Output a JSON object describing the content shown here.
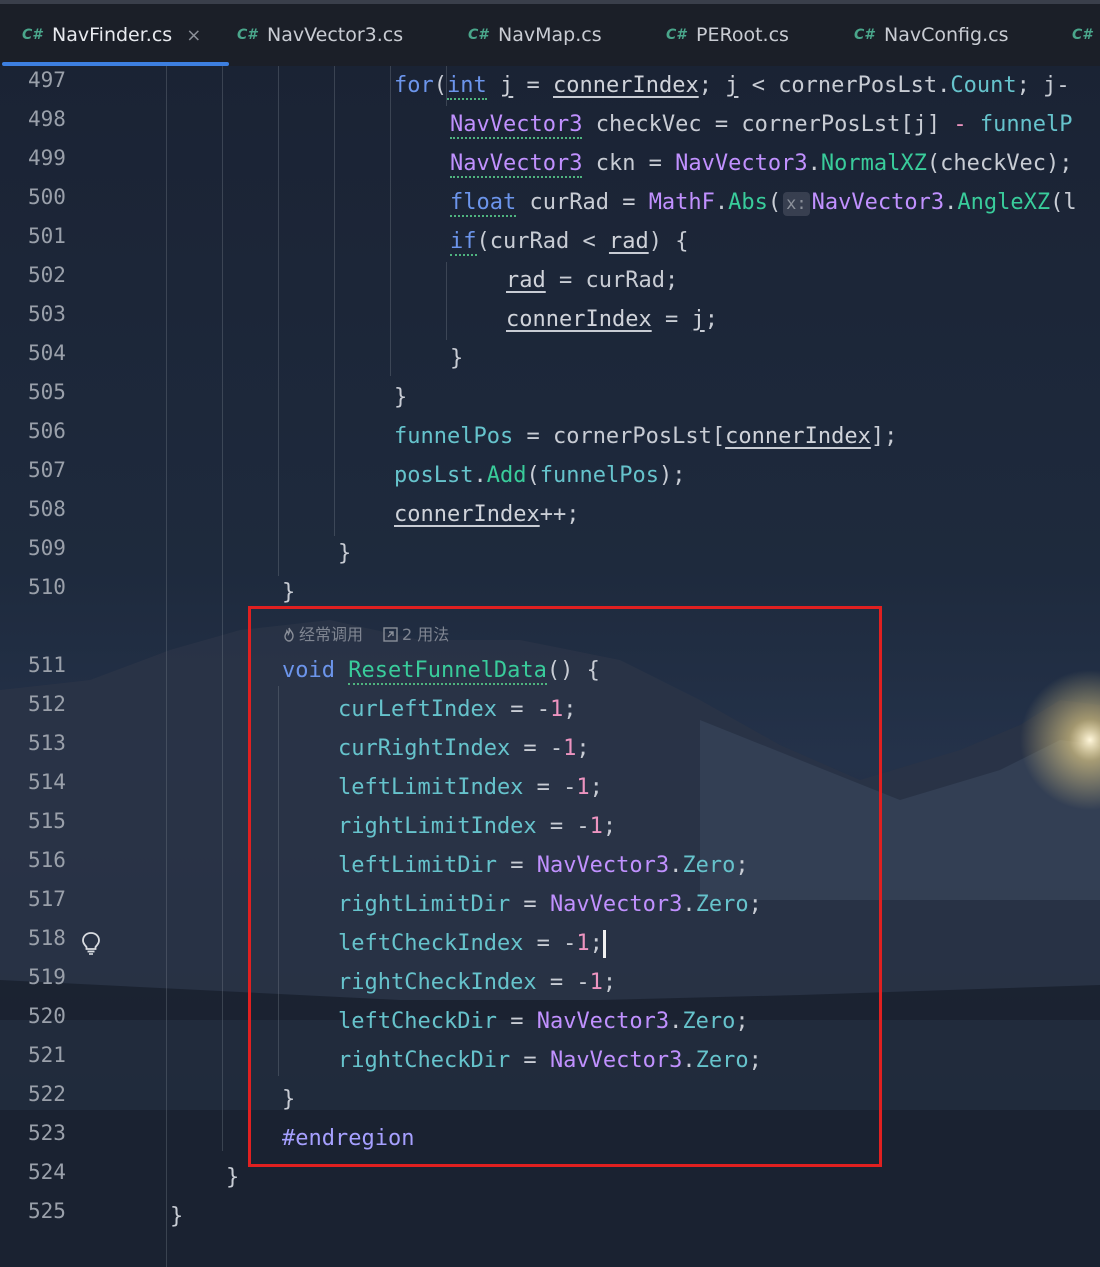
{
  "tabs": [
    {
      "lang": "C#",
      "label": "NavFinder.cs",
      "close": "×",
      "active": true
    },
    {
      "lang": "C#",
      "label": "NavVector3.cs"
    },
    {
      "lang": "C#",
      "label": "NavMap.cs"
    },
    {
      "lang": "C#",
      "label": "PERoot.cs"
    },
    {
      "lang": "C#",
      "label": "NavConfig.cs"
    },
    {
      "lang": "C#",
      "label": ""
    }
  ],
  "hints": {
    "frequency": "经常调用",
    "usages": "2 用法"
  },
  "inlay_param": "x:",
  "line_numbers": [
    "497",
    "498",
    "499",
    "500",
    "501",
    "502",
    "503",
    "504",
    "505",
    "506",
    "507",
    "508",
    "509",
    "510",
    "511",
    "512",
    "513",
    "514",
    "515",
    "516",
    "517",
    "518",
    "519",
    "520",
    "521",
    "522",
    "523",
    "524",
    "525"
  ],
  "code": {
    "l497": [
      "for",
      "(",
      "int",
      " ",
      "j",
      " = ",
      "connerIndex",
      "; ",
      "j",
      " < cornerPosLst.",
      "Count",
      "; j-"
    ],
    "l498": [
      "NavVector3",
      " checkVec = cornerPosLst[j] ",
      "-",
      " funnelP"
    ],
    "l499": [
      "NavVector3",
      " ckn = ",
      "NavVector3",
      ".",
      "NormalXZ",
      "(checkVec);"
    ],
    "l500": [
      "float",
      " curRad = ",
      "MathF",
      ".",
      "Abs",
      "(",
      "NavVector3",
      ".",
      "AngleXZ",
      "(l"
    ],
    "l501": [
      "if",
      "(curRad < ",
      "rad",
      ") {"
    ],
    "l502": [
      "rad",
      " = curRad;"
    ],
    "l503": [
      "connerIndex",
      " = ",
      "j",
      ";"
    ],
    "l504": [
      "}"
    ],
    "l505": [
      "}"
    ],
    "l506": [
      "funnelPos",
      " = cornerPosLst[",
      "connerIndex",
      "];"
    ],
    "l507": [
      "posLst",
      ".",
      "Add",
      "(",
      "funnelPos",
      ");"
    ],
    "l508": [
      "connerIndex",
      "++;"
    ],
    "l509": [
      "}"
    ],
    "l510": [
      "}"
    ],
    "l511": [
      "void",
      " ",
      "ResetFunnelData",
      "() {"
    ],
    "l512": [
      "curLeftIndex",
      " = -",
      "1",
      ";"
    ],
    "l513": [
      "curRightIndex",
      " = -",
      "1",
      ";"
    ],
    "l514": [
      "leftLimitIndex",
      " = -",
      "1",
      ";"
    ],
    "l515": [
      "rightLimitIndex",
      " = -",
      "1",
      ";"
    ],
    "l516": [
      "leftLimitDir",
      " = ",
      "NavVector3",
      ".",
      "Zero",
      ";"
    ],
    "l517": [
      "rightLimitDir",
      " = ",
      "NavVector3",
      ".",
      "Zero",
      ";"
    ],
    "l518": [
      "leftCheckIndex",
      " = -",
      "1",
      ";"
    ],
    "l519": [
      "rightCheckIndex",
      " = -",
      "1",
      ";"
    ],
    "l520": [
      "leftCheckDir",
      " = ",
      "NavVector3",
      ".",
      "Zero",
      ";"
    ],
    "l521": [
      "rightCheckDir",
      " = ",
      "NavVector3",
      ".",
      "Zero",
      ";"
    ],
    "l522": [
      "}"
    ],
    "l523": [
      "#endregion"
    ],
    "l524": [
      "}"
    ],
    "l525": [
      "}"
    ]
  },
  "colors": {
    "keyword": "#6c95eb",
    "type": "#c191ff",
    "field": "#66c3cc",
    "method": "#39cc9b",
    "number": "#ed94c0",
    "highlight_box": "#e02020",
    "active_tab_underline": "#3d7fe0"
  },
  "icons": [
    "flame-icon",
    "usages-link-icon",
    "lightbulb-icon",
    "close-icon"
  ]
}
